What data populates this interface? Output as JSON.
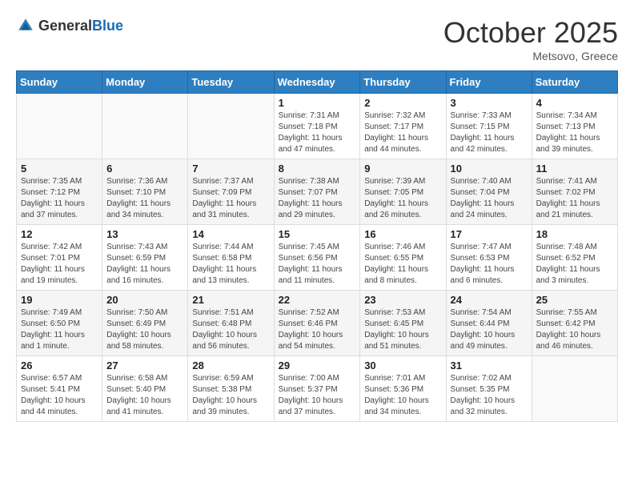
{
  "header": {
    "logo_general": "General",
    "logo_blue": "Blue",
    "month_title": "October 2025",
    "location": "Metsovo, Greece"
  },
  "days_of_week": [
    "Sunday",
    "Monday",
    "Tuesday",
    "Wednesday",
    "Thursday",
    "Friday",
    "Saturday"
  ],
  "weeks": [
    [
      {
        "day": "",
        "sunrise": "",
        "sunset": "",
        "daylight": ""
      },
      {
        "day": "",
        "sunrise": "",
        "sunset": "",
        "daylight": ""
      },
      {
        "day": "",
        "sunrise": "",
        "sunset": "",
        "daylight": ""
      },
      {
        "day": "1",
        "sunrise": "Sunrise: 7:31 AM",
        "sunset": "Sunset: 7:18 PM",
        "daylight": "Daylight: 11 hours and 47 minutes."
      },
      {
        "day": "2",
        "sunrise": "Sunrise: 7:32 AM",
        "sunset": "Sunset: 7:17 PM",
        "daylight": "Daylight: 11 hours and 44 minutes."
      },
      {
        "day": "3",
        "sunrise": "Sunrise: 7:33 AM",
        "sunset": "Sunset: 7:15 PM",
        "daylight": "Daylight: 11 hours and 42 minutes."
      },
      {
        "day": "4",
        "sunrise": "Sunrise: 7:34 AM",
        "sunset": "Sunset: 7:13 PM",
        "daylight": "Daylight: 11 hours and 39 minutes."
      }
    ],
    [
      {
        "day": "5",
        "sunrise": "Sunrise: 7:35 AM",
        "sunset": "Sunset: 7:12 PM",
        "daylight": "Daylight: 11 hours and 37 minutes."
      },
      {
        "day": "6",
        "sunrise": "Sunrise: 7:36 AM",
        "sunset": "Sunset: 7:10 PM",
        "daylight": "Daylight: 11 hours and 34 minutes."
      },
      {
        "day": "7",
        "sunrise": "Sunrise: 7:37 AM",
        "sunset": "Sunset: 7:09 PM",
        "daylight": "Daylight: 11 hours and 31 minutes."
      },
      {
        "day": "8",
        "sunrise": "Sunrise: 7:38 AM",
        "sunset": "Sunset: 7:07 PM",
        "daylight": "Daylight: 11 hours and 29 minutes."
      },
      {
        "day": "9",
        "sunrise": "Sunrise: 7:39 AM",
        "sunset": "Sunset: 7:05 PM",
        "daylight": "Daylight: 11 hours and 26 minutes."
      },
      {
        "day": "10",
        "sunrise": "Sunrise: 7:40 AM",
        "sunset": "Sunset: 7:04 PM",
        "daylight": "Daylight: 11 hours and 24 minutes."
      },
      {
        "day": "11",
        "sunrise": "Sunrise: 7:41 AM",
        "sunset": "Sunset: 7:02 PM",
        "daylight": "Daylight: 11 hours and 21 minutes."
      }
    ],
    [
      {
        "day": "12",
        "sunrise": "Sunrise: 7:42 AM",
        "sunset": "Sunset: 7:01 PM",
        "daylight": "Daylight: 11 hours and 19 minutes."
      },
      {
        "day": "13",
        "sunrise": "Sunrise: 7:43 AM",
        "sunset": "Sunset: 6:59 PM",
        "daylight": "Daylight: 11 hours and 16 minutes."
      },
      {
        "day": "14",
        "sunrise": "Sunrise: 7:44 AM",
        "sunset": "Sunset: 6:58 PM",
        "daylight": "Daylight: 11 hours and 13 minutes."
      },
      {
        "day": "15",
        "sunrise": "Sunrise: 7:45 AM",
        "sunset": "Sunset: 6:56 PM",
        "daylight": "Daylight: 11 hours and 11 minutes."
      },
      {
        "day": "16",
        "sunrise": "Sunrise: 7:46 AM",
        "sunset": "Sunset: 6:55 PM",
        "daylight": "Daylight: 11 hours and 8 minutes."
      },
      {
        "day": "17",
        "sunrise": "Sunrise: 7:47 AM",
        "sunset": "Sunset: 6:53 PM",
        "daylight": "Daylight: 11 hours and 6 minutes."
      },
      {
        "day": "18",
        "sunrise": "Sunrise: 7:48 AM",
        "sunset": "Sunset: 6:52 PM",
        "daylight": "Daylight: 11 hours and 3 minutes."
      }
    ],
    [
      {
        "day": "19",
        "sunrise": "Sunrise: 7:49 AM",
        "sunset": "Sunset: 6:50 PM",
        "daylight": "Daylight: 11 hours and 1 minute."
      },
      {
        "day": "20",
        "sunrise": "Sunrise: 7:50 AM",
        "sunset": "Sunset: 6:49 PM",
        "daylight": "Daylight: 10 hours and 58 minutes."
      },
      {
        "day": "21",
        "sunrise": "Sunrise: 7:51 AM",
        "sunset": "Sunset: 6:48 PM",
        "daylight": "Daylight: 10 hours and 56 minutes."
      },
      {
        "day": "22",
        "sunrise": "Sunrise: 7:52 AM",
        "sunset": "Sunset: 6:46 PM",
        "daylight": "Daylight: 10 hours and 54 minutes."
      },
      {
        "day": "23",
        "sunrise": "Sunrise: 7:53 AM",
        "sunset": "Sunset: 6:45 PM",
        "daylight": "Daylight: 10 hours and 51 minutes."
      },
      {
        "day": "24",
        "sunrise": "Sunrise: 7:54 AM",
        "sunset": "Sunset: 6:44 PM",
        "daylight": "Daylight: 10 hours and 49 minutes."
      },
      {
        "day": "25",
        "sunrise": "Sunrise: 7:55 AM",
        "sunset": "Sunset: 6:42 PM",
        "daylight": "Daylight: 10 hours and 46 minutes."
      }
    ],
    [
      {
        "day": "26",
        "sunrise": "Sunrise: 6:57 AM",
        "sunset": "Sunset: 5:41 PM",
        "daylight": "Daylight: 10 hours and 44 minutes."
      },
      {
        "day": "27",
        "sunrise": "Sunrise: 6:58 AM",
        "sunset": "Sunset: 5:40 PM",
        "daylight": "Daylight: 10 hours and 41 minutes."
      },
      {
        "day": "28",
        "sunrise": "Sunrise: 6:59 AM",
        "sunset": "Sunset: 5:38 PM",
        "daylight": "Daylight: 10 hours and 39 minutes."
      },
      {
        "day": "29",
        "sunrise": "Sunrise: 7:00 AM",
        "sunset": "Sunset: 5:37 PM",
        "daylight": "Daylight: 10 hours and 37 minutes."
      },
      {
        "day": "30",
        "sunrise": "Sunrise: 7:01 AM",
        "sunset": "Sunset: 5:36 PM",
        "daylight": "Daylight: 10 hours and 34 minutes."
      },
      {
        "day": "31",
        "sunrise": "Sunrise: 7:02 AM",
        "sunset": "Sunset: 5:35 PM",
        "daylight": "Daylight: 10 hours and 32 minutes."
      },
      {
        "day": "",
        "sunrise": "",
        "sunset": "",
        "daylight": ""
      }
    ]
  ]
}
